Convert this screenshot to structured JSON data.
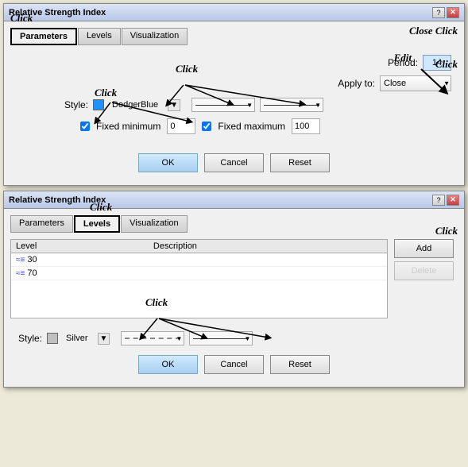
{
  "top_dialog": {
    "title": "Relative Strength Index",
    "tabs": [
      {
        "label": "Parameters",
        "active": true,
        "highlighted": true
      },
      {
        "label": "Levels",
        "active": false
      },
      {
        "label": "Visualization",
        "active": false
      }
    ],
    "edit_label": "Edit",
    "period_label": "Period:",
    "period_value": "14",
    "apply_label": "Apply to:",
    "apply_value": "Close",
    "apply_click": "Click",
    "style_label": "Style:",
    "style_color": "#1E90FF",
    "style_name": "DodgerBlue",
    "fixed_min_label": "Fixed minimum",
    "fixed_min_checked": true,
    "fixed_min_value": "0",
    "fixed_max_label": "Fixed maximum",
    "fixed_max_checked": true,
    "fixed_max_value": "100",
    "click_label": "Click",
    "ok_label": "OK",
    "cancel_label": "Cancel",
    "reset_label": "Reset"
  },
  "bottom_dialog": {
    "title": "Relative Strength Index",
    "tabs": [
      {
        "label": "Parameters",
        "active": false
      },
      {
        "label": "Levels",
        "active": true,
        "highlighted": true
      },
      {
        "label": "Visualization",
        "active": false
      }
    ],
    "tab_click": "Click",
    "levels_header_level": "Level",
    "levels_header_desc": "Description",
    "levels": [
      {
        "value": "30",
        "description": ""
      },
      {
        "value": "70",
        "description": ""
      }
    ],
    "add_label": "Add",
    "add_click": "Click",
    "delete_label": "Delete",
    "style_label": "Style:",
    "style_color": "#C0C0C0",
    "style_name": "Silver",
    "click_label": "Click",
    "ok_label": "OK",
    "cancel_label": "Cancel",
    "reset_label": "Reset"
  },
  "close_click_annotation": "Close Click"
}
